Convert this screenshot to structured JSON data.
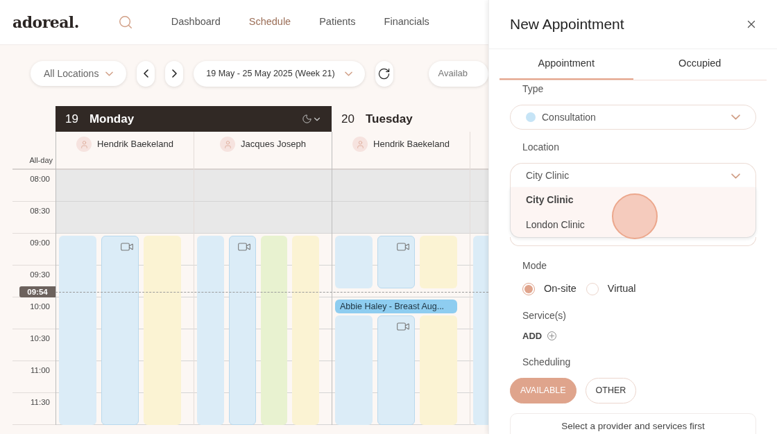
{
  "app": {
    "logo": "adoreal.",
    "nav": [
      {
        "label": "Dashboard",
        "selected": false
      },
      {
        "label": "Schedule",
        "selected": true
      },
      {
        "label": "Patients",
        "selected": false
      },
      {
        "label": "Financials",
        "selected": false
      }
    ]
  },
  "toolbar": {
    "location": "All Locations",
    "date_range": "19 May - 25 May 2025 (Week 21)",
    "partial_button": "Availab"
  },
  "calendar": {
    "all_day_label": "All-day",
    "times": [
      "08:00",
      "08:30",
      "09:00",
      "09:30",
      "10:00",
      "10:30",
      "11:00",
      "11:30"
    ],
    "now": "09:54",
    "days": [
      {
        "date": "19",
        "weekday": "Monday",
        "selected": true,
        "columns": [
          {
            "provider": "Hendrik Baekeland",
            "lanes": [
              {
                "color": "#dbecf7",
                "video": false
              },
              {
                "color": "#dbecf7",
                "video": true
              },
              {
                "color": "#fbf3d3",
                "video": false
              }
            ]
          },
          {
            "provider": "Jacques Joseph",
            "lanes": [
              {
                "color": "#dbecf7",
                "video": false
              },
              {
                "color": "#dbecf7",
                "video": true
              },
              {
                "color": "#e8f2d0",
                "video": false
              },
              {
                "color": "#fbf3d3",
                "video": false
              }
            ]
          }
        ]
      },
      {
        "date": "20",
        "weekday": "Tuesday",
        "selected": false,
        "columns": [
          {
            "provider": "Hendrik Baekeland",
            "event": "Abbie Haley - Breast Aug...",
            "lanes": [
              {
                "color": "#dbecf7",
                "video": false
              },
              {
                "color": "#dbecf7",
                "video": true
              },
              {
                "color": "#fbf3d3",
                "video": false
              }
            ]
          },
          {
            "lanes": [
              {
                "color": "#dbecf7",
                "video": false
              }
            ]
          }
        ]
      }
    ]
  },
  "panel": {
    "title": "New Appointment",
    "tabs": [
      {
        "label": "Appointment",
        "selected": true
      },
      {
        "label": "Occupied",
        "selected": false
      }
    ],
    "type": {
      "label": "Type",
      "value": "Consultation"
    },
    "location": {
      "label": "Location",
      "value": "City Clinic",
      "expanded": true,
      "options": [
        {
          "label": "City Clinic",
          "selected": true
        },
        {
          "label": "London Clinic",
          "selected": false
        }
      ]
    },
    "mode": {
      "label": "Mode",
      "options": [
        {
          "label": "On-site",
          "selected": true
        },
        {
          "label": "Virtual",
          "selected": false
        }
      ]
    },
    "services": {
      "label": "Service(s)",
      "add": "ADD"
    },
    "scheduling": {
      "label": "Scheduling",
      "options": [
        {
          "label": "AVAILABLE",
          "selected": true
        },
        {
          "label": "OTHER",
          "selected": false
        }
      ],
      "message": "Select a provider and services first"
    }
  }
}
